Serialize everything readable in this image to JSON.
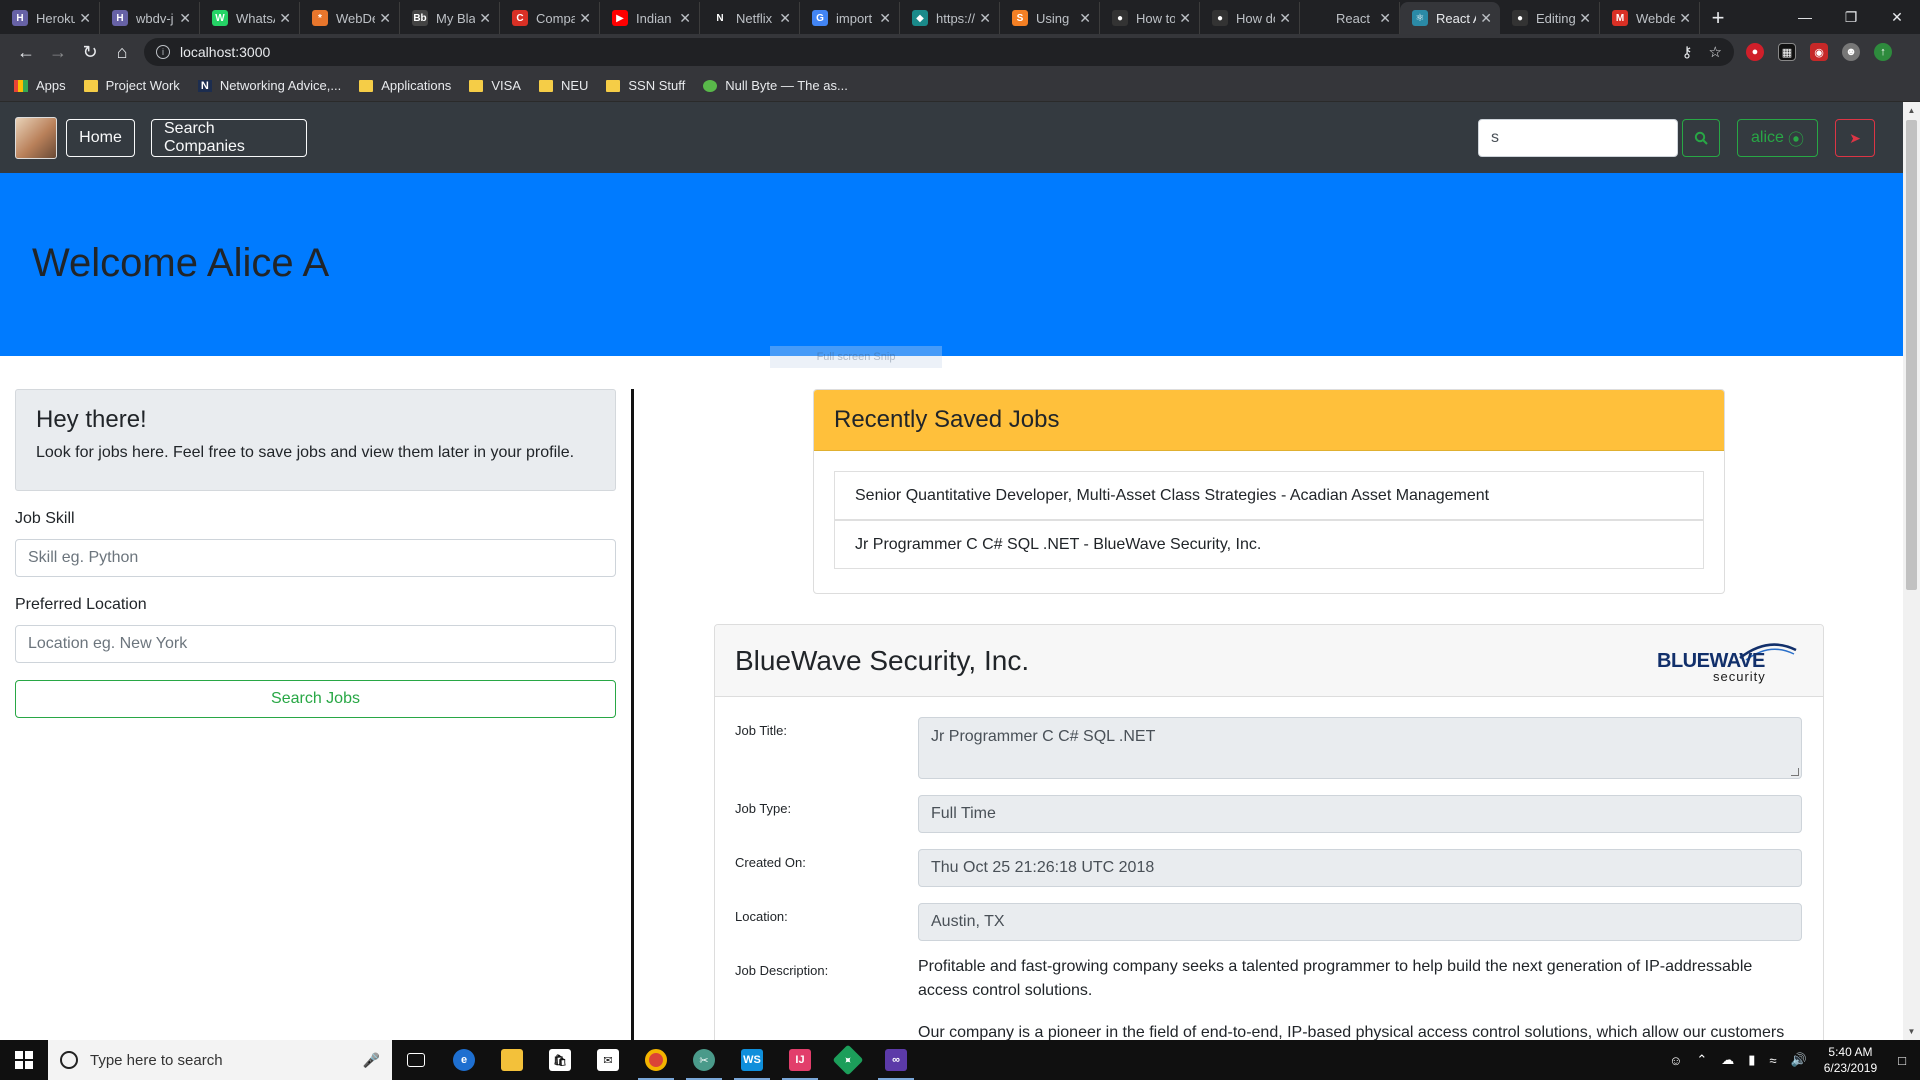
{
  "browser": {
    "tabs": [
      {
        "label": "Heroku",
        "color": "#6762a6",
        "glyph": "H"
      },
      {
        "label": "wbdv-j",
        "color": "#6762a6",
        "glyph": "H"
      },
      {
        "label": "WhatsApp",
        "color": "#25d366",
        "glyph": "W"
      },
      {
        "label": "WebDev",
        "color": "#e8762c",
        "glyph": "*"
      },
      {
        "label": "My Blackboard",
        "color": "#444444",
        "glyph": "Bb"
      },
      {
        "label": "Company",
        "color": "#d93025",
        "glyph": "C"
      },
      {
        "label": "Indian",
        "color": "#ff0000",
        "glyph": "▶"
      },
      {
        "label": "Netflix",
        "color": "#202124",
        "glyph": "N"
      },
      {
        "label": "import",
        "color": "#4285f4",
        "glyph": "G"
      },
      {
        "label": "https://",
        "color": "#1a8a8a",
        "glyph": "◆"
      },
      {
        "label": "Using",
        "color": "#f48024",
        "glyph": "S"
      },
      {
        "label": "How to",
        "color": "#333333",
        "glyph": "●"
      },
      {
        "label": "How do",
        "color": "#333333",
        "glyph": "●"
      },
      {
        "label": "React",
        "color": "#202124",
        "glyph": ""
      },
      {
        "label": "React App",
        "color": "#2b8aa6",
        "glyph": "⚛"
      },
      {
        "label": "Editing",
        "color": "#333333",
        "glyph": "●"
      },
      {
        "label": "Webdev",
        "color": "#d93025",
        "glyph": "M"
      }
    ],
    "active_tab_index": 14,
    "url": "localhost:3000",
    "bookmarks": [
      {
        "label": "Apps",
        "type": "apps"
      },
      {
        "label": "Project Work",
        "type": "folder"
      },
      {
        "label": "Networking Advice,...",
        "type": "n"
      },
      {
        "label": "Applications",
        "type": "folder"
      },
      {
        "label": "VISA",
        "type": "folder"
      },
      {
        "label": "NEU",
        "type": "folder"
      },
      {
        "label": "SSN Stuff",
        "type": "folder"
      },
      {
        "label": "Null Byte — The as...",
        "type": "nb"
      }
    ]
  },
  "nav": {
    "home": "Home",
    "search_companies": "Search Companies",
    "search_value": "s",
    "user": "alice"
  },
  "jumbotron": {
    "title": "Welcome Alice A"
  },
  "overlay": {
    "fullscreen": "Full screen Snip"
  },
  "left": {
    "hey_title": "Hey there!",
    "hey_text": "Look for jobs here. Feel free to save jobs and view them later in your profile.",
    "skill_label": "Job Skill",
    "skill_placeholder": "Skill eg. Python",
    "location_label": "Preferred Location",
    "location_placeholder": "Location eg. New York",
    "search_button": "Search Jobs"
  },
  "saved": {
    "title": "Recently Saved Jobs",
    "items": [
      "Senior Quantitative Developer, Multi-Asset Class Strategies - Acadian Asset Management",
      "Jr Programmer C C# SQL .NET - BlueWave Security, Inc."
    ]
  },
  "detail": {
    "company": "BlueWave Security, Inc.",
    "logo_main": "BLUEWAVE",
    "logo_sub": "security",
    "job_title_label": "Job Title:",
    "job_title": "Jr Programmer C C# SQL .NET",
    "job_type_label": "Job Type:",
    "job_type": "Full Time",
    "created_label": "Created On:",
    "created": "Thu Oct 25 21:26:18 UTC 2018",
    "location_label": "Location:",
    "location": "Austin, TX",
    "desc_label": "Job Description:",
    "desc_p1": "Profitable and fast-growing company seeks a talented programmer to help build the next generation of IP-addressable access control solutions.",
    "desc_p2": "Our company is a pioneer in the field of end-to-end, IP-based physical access control solutions, which allow our customers to"
  },
  "taskbar": {
    "search_placeholder": "Type here to search",
    "time": "5:40 AM",
    "date": "6/23/2019"
  }
}
